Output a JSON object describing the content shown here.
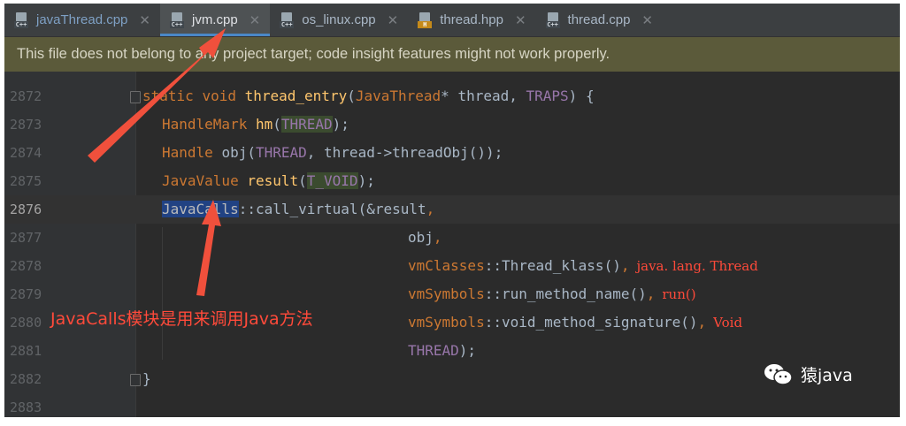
{
  "tabs": [
    {
      "label": "javaThread.cpp",
      "icon": "cpp-file-icon",
      "badge": "C++",
      "active": false
    },
    {
      "label": "jvm.cpp",
      "icon": "cpp-file-icon",
      "badge": "C++",
      "active": true
    },
    {
      "label": "os_linux.cpp",
      "icon": "cpp-file-icon",
      "badge": "C++",
      "active": false
    },
    {
      "label": "thread.hpp",
      "icon": "header-file-icon",
      "badge": "H",
      "active": false
    },
    {
      "label": "thread.cpp",
      "icon": "cpp-file-icon",
      "badge": "C++",
      "active": false
    }
  ],
  "banner": {
    "text": "This file does not belong to any project target; code insight features might not work properly."
  },
  "line_numbers": [
    "2872",
    "2873",
    "2874",
    "2875",
    "2876",
    "2877",
    "2878",
    "2879",
    "2880",
    "2881",
    "2882",
    "2883"
  ],
  "code": {
    "l2872": {
      "a": "static ",
      "b": "void ",
      "c": "thread_entry",
      "d": "(",
      "e": "JavaThread",
      "f": "* thread, ",
      "g": "TRAPS",
      "h": ") {"
    },
    "l2873": {
      "a": "HandleMark ",
      "b": "hm",
      "c": "(",
      "d": "THREAD",
      "e": ");"
    },
    "l2874": {
      "a": "Handle ",
      "b": "obj(",
      "c": "THREAD",
      "d": ", thread->threadObj());"
    },
    "l2875": {
      "a": "JavaValue ",
      "b": "result",
      "c": "(",
      "d": "T_VOID",
      "e": ");"
    },
    "l2876": {
      "a": "JavaCalls",
      "b": "::call_virtual(&result",
      "c": ","
    },
    "l2877": {
      "a": "obj",
      "b": ","
    },
    "l2878": {
      "a": "vmClasses",
      "b": "::Thread_klass()",
      "c": ",",
      "ann": "java. lang. Thread"
    },
    "l2879": {
      "a": "vmSymbols",
      "b": "::run_method_name()",
      "c": ",",
      "ann": "run()"
    },
    "l2880": {
      "a": "vmSymbols",
      "b": "::void_method_signature()",
      "c": ",",
      "ann": "Void"
    },
    "l2881": {
      "a": "THREAD",
      "b": ");"
    },
    "l2882": {
      "a": "}"
    }
  },
  "annotation_note": "JavaCalls模块是用来调用Java方法",
  "watermark": "猿java",
  "colors": {
    "arrow": "#f0503c",
    "annotation": "#ff4a3a",
    "active_tab_underline": "#4a88c7"
  }
}
